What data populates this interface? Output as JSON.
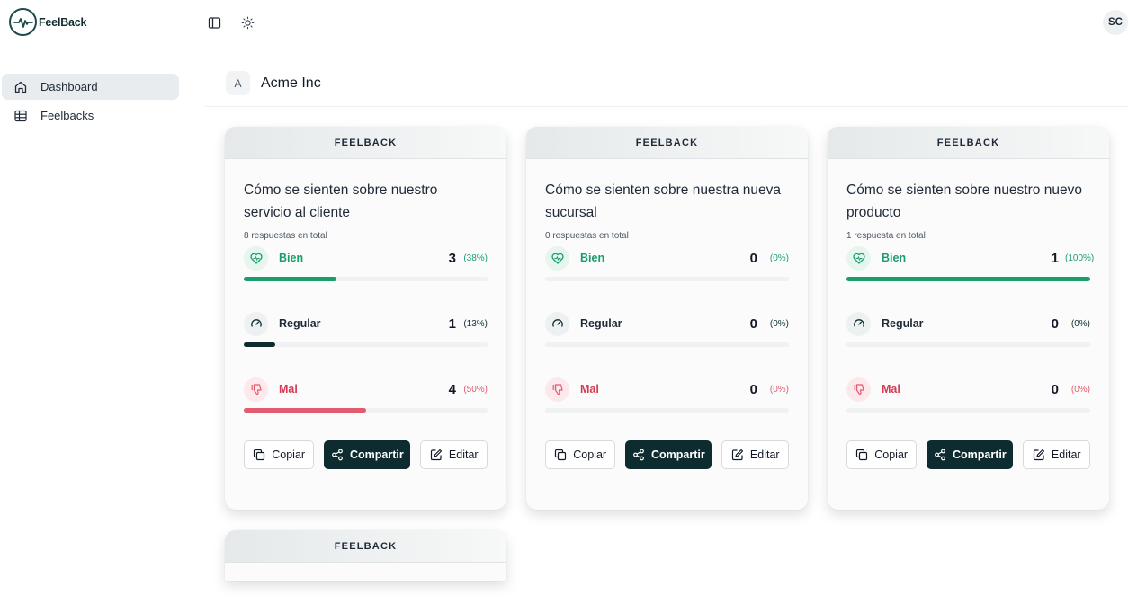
{
  "app": {
    "logo_text": "FeelBack"
  },
  "sidebar": {
    "items": [
      {
        "label": "Dashboard",
        "icon": "home-icon",
        "active": true
      },
      {
        "label": "Feelbacks",
        "icon": "table-icon",
        "active": false
      }
    ]
  },
  "topbar": {
    "avatar_initials": "SC"
  },
  "org": {
    "initial": "A",
    "name": "Acme Inc"
  },
  "labels": {
    "good": "Bien",
    "regular": "Regular",
    "bad": "Mal",
    "copy": "Copiar",
    "share": "Compartir",
    "edit": "Editar"
  },
  "colors": {
    "good": "#1a9e6b",
    "regular": "#0e2c30",
    "bad": "#e25c6f",
    "dark": "#0e2c30"
  },
  "cards": [
    {
      "header": "FEELBACK",
      "title": "Cómo se sienten sobre nuestro servicio al cliente",
      "total": "8 respuestas en total",
      "stats": [
        {
          "key": "good",
          "count": "3",
          "pct": "(38%)",
          "fill": 38
        },
        {
          "key": "regular",
          "count": "1",
          "pct": "(13%)",
          "fill": 13
        },
        {
          "key": "bad",
          "count": "4",
          "pct": "(50%)",
          "fill": 50
        }
      ]
    },
    {
      "header": "FEELBACK",
      "title": "Cómo se sienten sobre nuestra nueva sucursal",
      "total": "0 respuestas en total",
      "stats": [
        {
          "key": "good",
          "count": "0",
          "pct": "(0%)",
          "fill": 0
        },
        {
          "key": "regular",
          "count": "0",
          "pct": "(0%)",
          "fill": 0
        },
        {
          "key": "bad",
          "count": "0",
          "pct": "(0%)",
          "fill": 0
        }
      ]
    },
    {
      "header": "FEELBACK",
      "title": "Cómo se sienten sobre nuestro nuevo producto",
      "total": "1 respuesta en total",
      "stats": [
        {
          "key": "good",
          "count": "1",
          "pct": "(100%)",
          "fill": 100
        },
        {
          "key": "regular",
          "count": "0",
          "pct": "(0%)",
          "fill": 0
        },
        {
          "key": "bad",
          "count": "0",
          "pct": "(0%)",
          "fill": 0
        }
      ]
    },
    {
      "header": "FEELBACK"
    }
  ]
}
